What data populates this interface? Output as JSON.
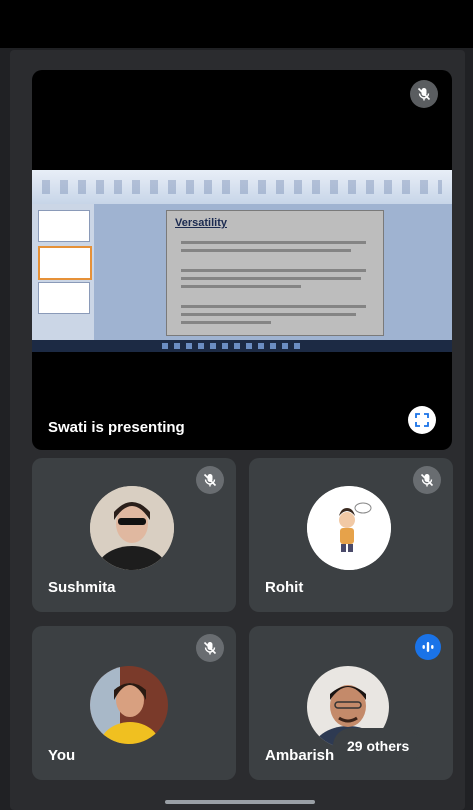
{
  "presentation": {
    "presenter_label": "Swati is presenting",
    "slide_title": "Versatility"
  },
  "participants": [
    {
      "name": "Sushmita",
      "muted": true
    },
    {
      "name": "Rohit",
      "muted": true
    },
    {
      "name": "You",
      "muted": true
    },
    {
      "name": "Ambarish",
      "speaking": true
    }
  ],
  "others_label": "29 others",
  "colors": {
    "background": "#202124",
    "tile": "#3c4043",
    "speaking_accent": "#1a73e8"
  }
}
